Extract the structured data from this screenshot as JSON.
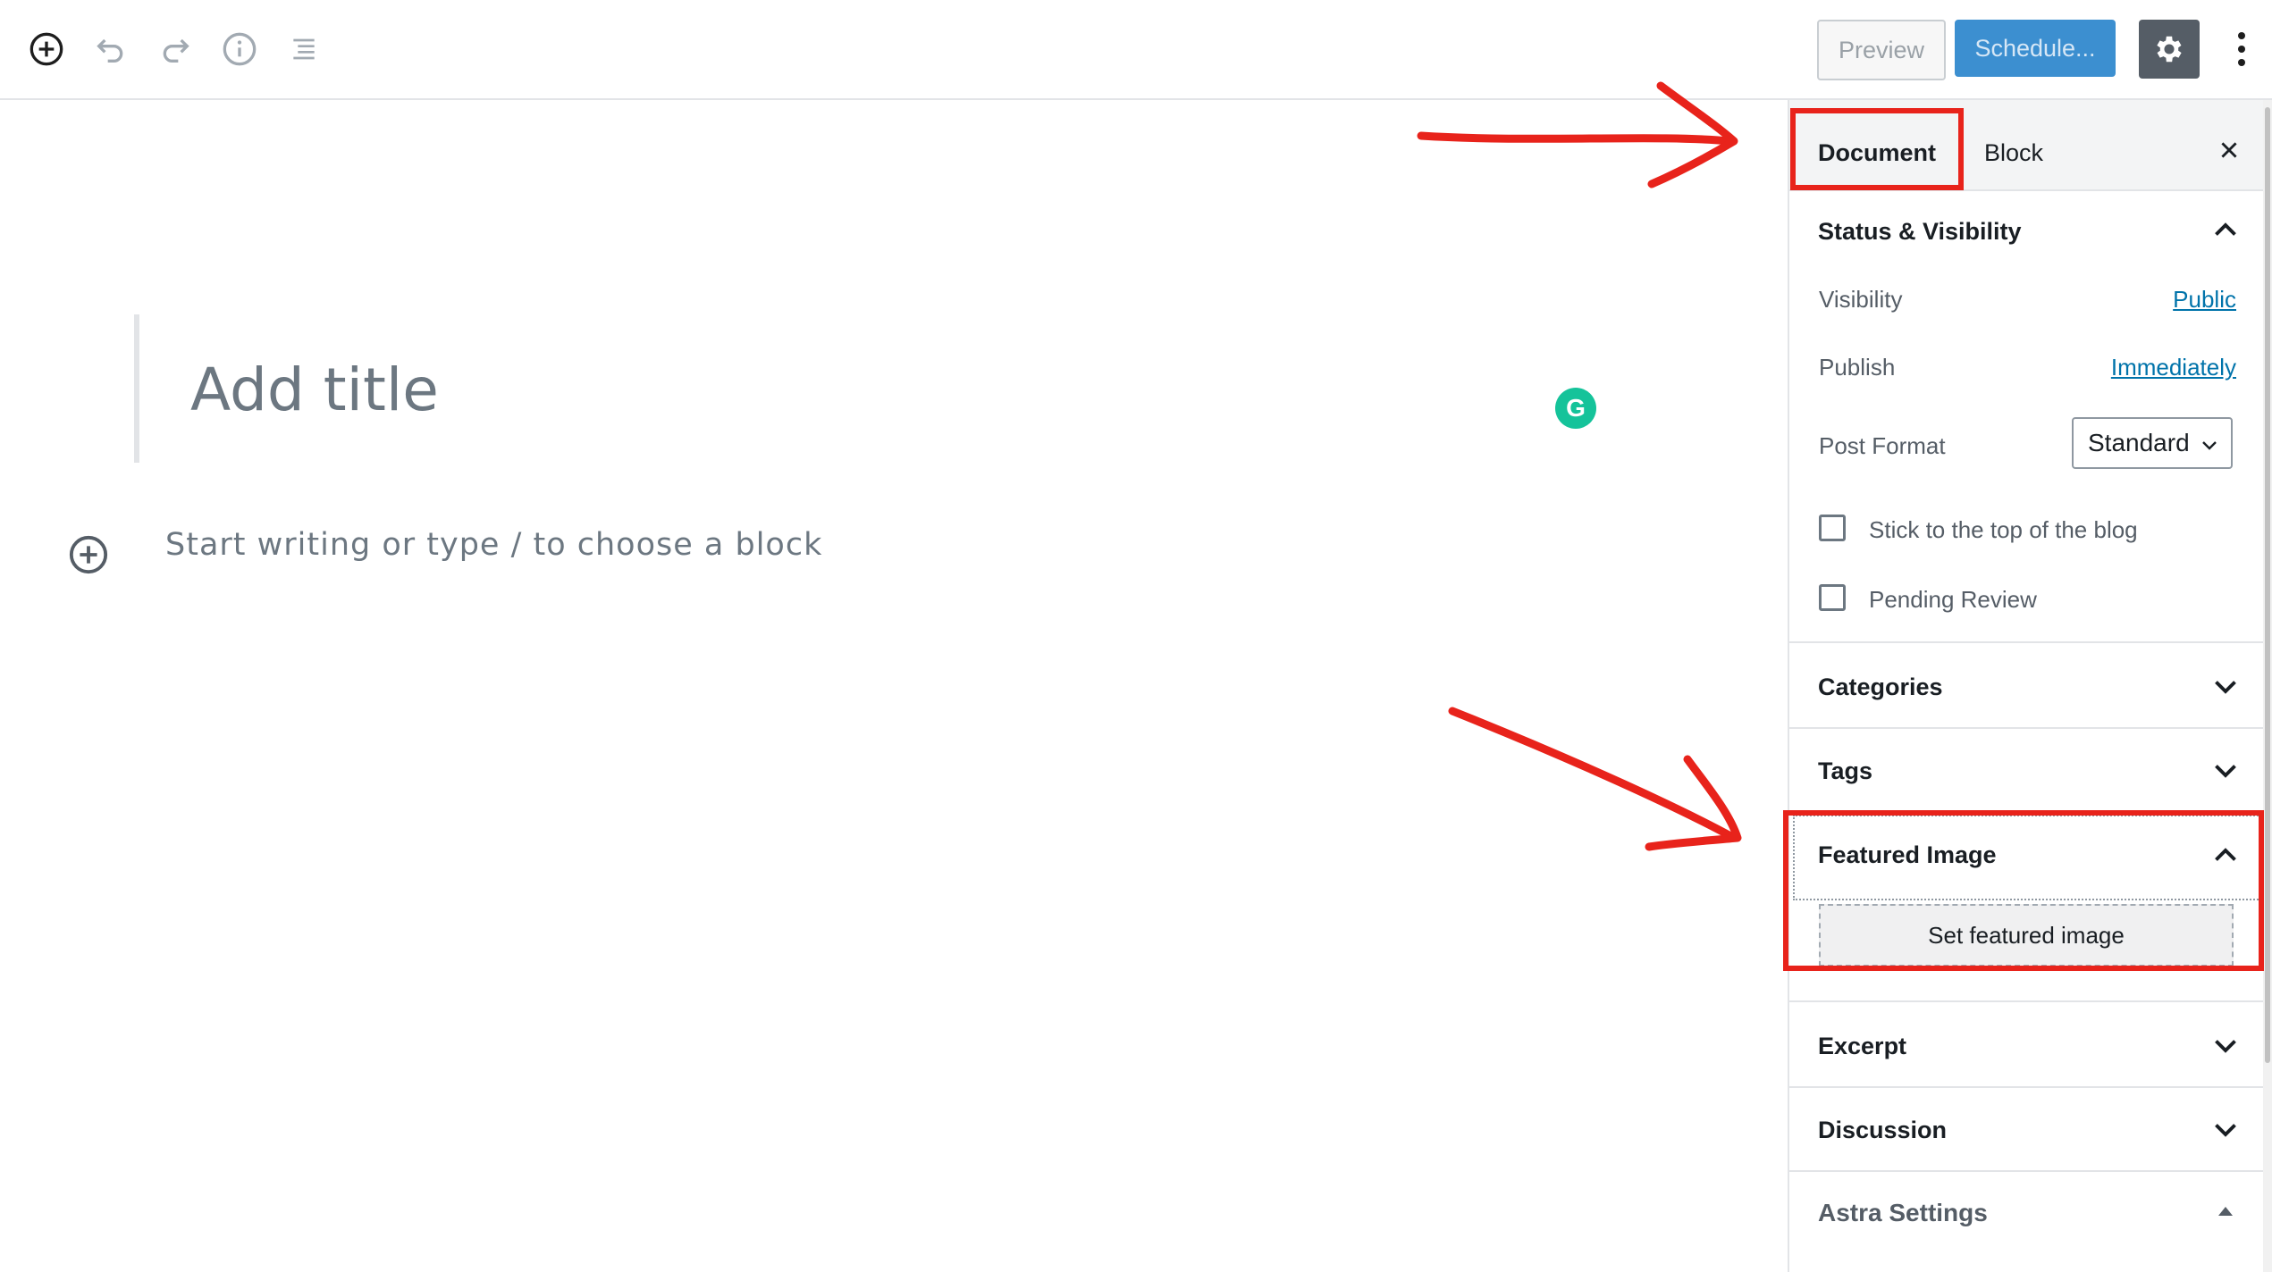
{
  "toolbar": {
    "icons": [
      "add-block-icon",
      "undo-icon",
      "redo-icon",
      "info-icon",
      "list-view-icon"
    ],
    "preview_label": "Preview",
    "schedule_label": "Schedule...",
    "colors": {
      "primary": "#3c8fd0",
      "settings_bg": "#555d66"
    }
  },
  "editor": {
    "title_placeholder": "Add title",
    "block_placeholder": "Start writing or type / to choose a block"
  },
  "sidebar": {
    "tabs": {
      "document": "Document",
      "block": "Block"
    },
    "status_visibility": {
      "title": "Status & Visibility",
      "visibility_label": "Visibility",
      "visibility_value": "Public",
      "publish_label": "Publish",
      "publish_value": "Immediately",
      "post_format_label": "Post Format",
      "post_format_value": "Standard",
      "stick_label": "Stick to the top of the blog",
      "pending_label": "Pending Review"
    },
    "categories": "Categories",
    "tags": "Tags",
    "featured_image": {
      "title": "Featured Image",
      "button": "Set featured image"
    },
    "excerpt": "Excerpt",
    "discussion": "Discussion",
    "astra_settings": "Astra Settings"
  },
  "annotation_color": "#e8231b"
}
